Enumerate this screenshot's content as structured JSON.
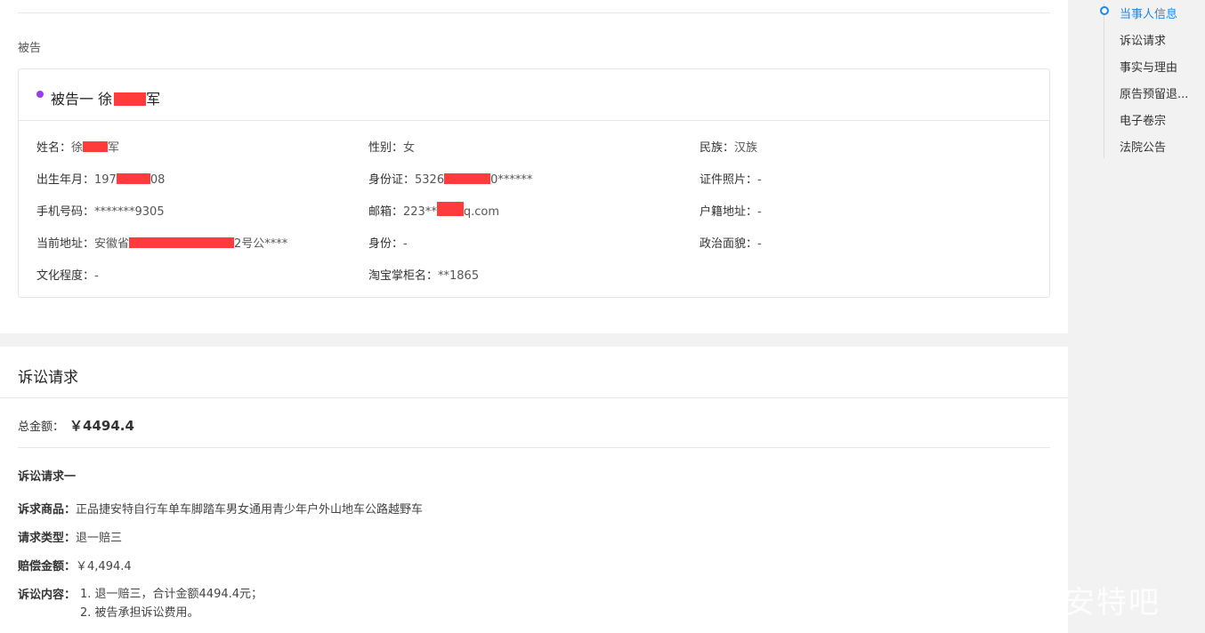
{
  "defendant_section": {
    "label": "被告",
    "party_title_prefix": "被告一 徐",
    "party_title_suffix": "军",
    "fields": {
      "name_k": "姓名：",
      "name_v_pre": "徐",
      "name_v_post": "军",
      "gender_k": "性别：",
      "gender_v": "女",
      "ethnic_k": "民族：",
      "ethnic_v": "汉族",
      "birth_k": "出生年月：",
      "birth_v_pre": "197",
      "birth_v_post": "08",
      "id_k": "身份证：",
      "id_v_pre": "5326",
      "id_v_post": "0******",
      "photo_k": "证件照片：",
      "photo_v": "-",
      "phone_k": "手机号码：",
      "phone_v": "*******9305",
      "email_k": "邮箱：",
      "email_v_pre": "223**",
      "email_v_post": "q.com",
      "hukou_k": "户籍地址：",
      "hukou_v": "-",
      "addr_k": "当前地址：",
      "addr_v_pre": "安徽省",
      "addr_v_post": "2号公****",
      "identity_k": "身份：",
      "identity_v": "-",
      "politics_k": "政治面貌：",
      "politics_v": "-",
      "edu_k": "文化程度：",
      "edu_v": "-",
      "shop_k": "淘宝掌柜名：",
      "shop_v": "**1865"
    }
  },
  "claims": {
    "title": "诉讼请求",
    "total_label": "总金额：",
    "total_value": "￥4494.4",
    "req_title": "诉讼请求一",
    "goods_k": "诉求商品：",
    "goods_v": "正品捷安特自行车单车脚踏车男女通用青少年户外山地车公路越野车",
    "type_k": "请求类型：",
    "type_v": "退一赔三",
    "comp_k": "赔偿金额：",
    "comp_v": "￥4,494.4",
    "content_k": "诉讼内容：",
    "content_line1": "1. 退一赔三，合计金额4494.4元；",
    "content_line2": "2. 被告承担诉讼费用。"
  },
  "sidenav": {
    "items": [
      "当事人信息",
      "诉讼请求",
      "事实与理由",
      "原告预留退...",
      "电子卷宗",
      "法院公告"
    ],
    "active_color": "#1e88e5"
  },
  "watermark": "捷安特吧",
  "colors": {
    "redaction": "#ff3b3b",
    "party_dot": "#9b3cf0"
  }
}
